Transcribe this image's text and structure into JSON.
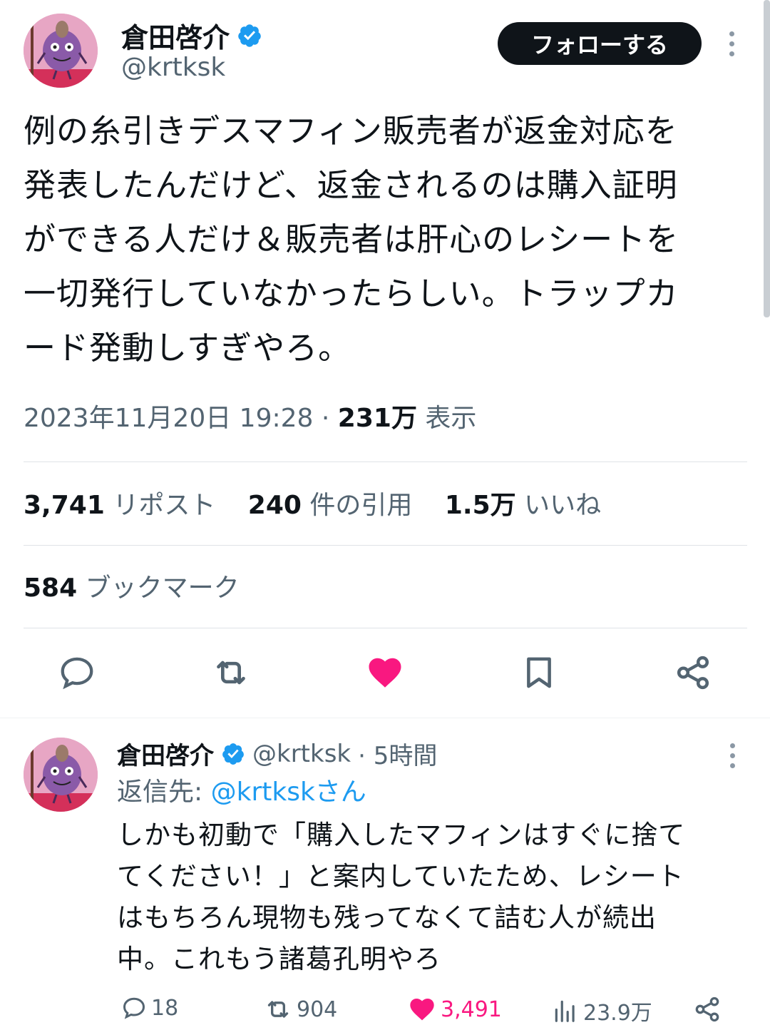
{
  "tweet": {
    "author_name": "倉田啓介",
    "author_handle": "@krtksk",
    "follow_label": "フォローする",
    "text": "例の糸引きデスマフィン販売者が返金対応を\n発表したんだけど、返金されるのは購入証明\nができる人だけ＆販売者は肝心のレシートを\n一切発行していなかったらしい。トラップカ\nード発動しすぎやろ。",
    "timestamp": "2023年11月20日 19:28",
    "dot": "·",
    "views_count": "231万",
    "views_label": "表示",
    "stats": {
      "reposts_count": "3,741",
      "reposts_label": "リポスト",
      "quotes_count": "240",
      "quotes_label": "件の引用",
      "likes_count": "1.5万",
      "likes_label": "いいね",
      "bookmarks_count": "584",
      "bookmarks_label": "ブックマーク"
    },
    "actions": [
      "reply-icon",
      "repost-icon",
      "like-icon",
      "bookmark-icon",
      "share-icon"
    ],
    "liked": true
  },
  "reply": {
    "author_name": "倉田啓介",
    "author_handle": "@krtksk",
    "time": "· 5時間",
    "reply_to_prefix": "返信先:",
    "reply_to_handle": "@krtkskさん",
    "text": "しかも初動で「購入したマフィンはすぐに捨て\nてください！」と案内していたため、レシート\nはもちろん現物も残ってなくて詰む人が続出\n中。これもう諸葛孔明やろ",
    "replies": "18",
    "reposts": "904",
    "likes": "3,491",
    "views": "23.9万"
  },
  "colors": {
    "like": "#f91880",
    "verified": "#1d9bf0",
    "link": "#1d9bf0",
    "secondary_text": "#536471"
  }
}
